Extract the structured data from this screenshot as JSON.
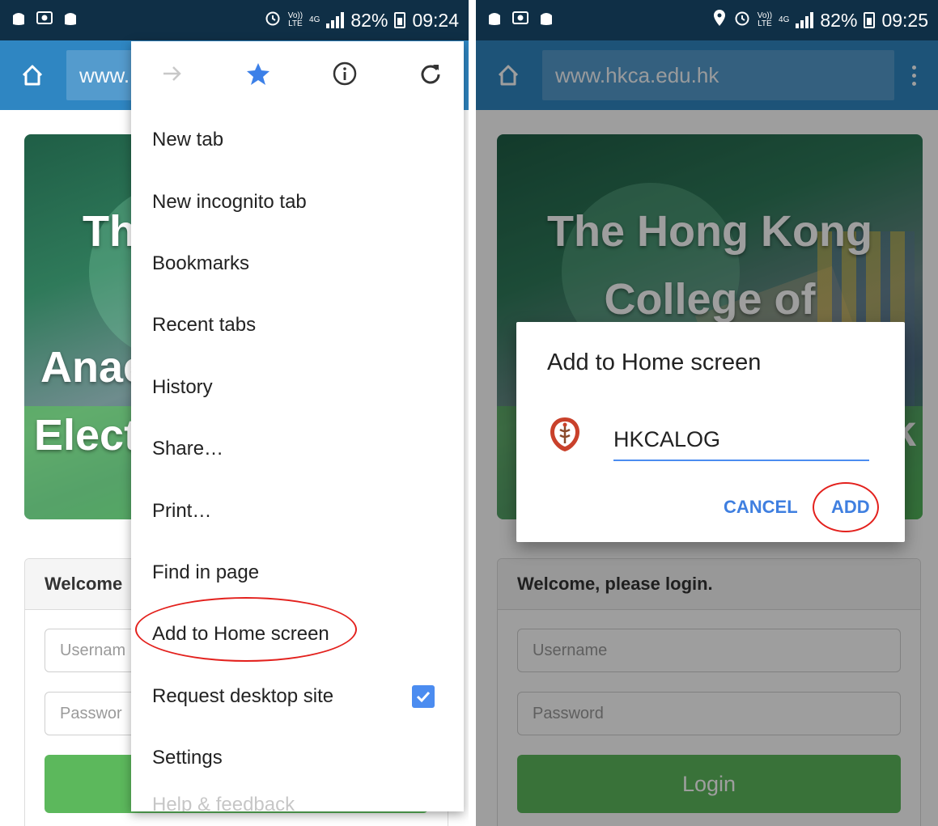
{
  "left": {
    "status": {
      "time": "09:24",
      "battery": "82%",
      "network": "4G",
      "volte_top": "Vo))",
      "volte_bottom": "LTE"
    },
    "url_partial": "www.",
    "hero_lines": [
      "Th",
      "Anae",
      "Elect"
    ],
    "login_header_partial": "Welcome",
    "username_placeholder_partial": "Usernam",
    "password_placeholder_partial": "Passwor",
    "menu": {
      "items": [
        "New tab",
        "New incognito tab",
        "Bookmarks",
        "Recent tabs",
        "History",
        "Share…",
        "Print…",
        "Find in page",
        "Add to Home screen",
        "Request desktop site",
        "Settings"
      ],
      "partial_item": "Help & feedback",
      "request_desktop_checked": true
    }
  },
  "right": {
    "status": {
      "time": "09:25",
      "battery": "82%",
      "network": "4G",
      "volte_top": "Vo))",
      "volte_bottom": "LTE"
    },
    "url": "www.hkca.edu.hk",
    "hero_lines": [
      "The Hong Kong",
      "College of"
    ],
    "hero_partial_right": "k",
    "login_header": "Welcome, please login.",
    "username_placeholder": "Username",
    "password_placeholder": "Password",
    "login_button": "Login",
    "dialog": {
      "title": "Add to Home screen",
      "app_name": "HKCALOG",
      "cancel": "CANCEL",
      "add": "ADD"
    }
  },
  "colors": {
    "status_bar": "#0f2f46",
    "toolbar": "#2f86c2",
    "accent_blue": "#4b8cf0",
    "annotation_red": "#e3211d",
    "login_green": "#5cb85c"
  }
}
